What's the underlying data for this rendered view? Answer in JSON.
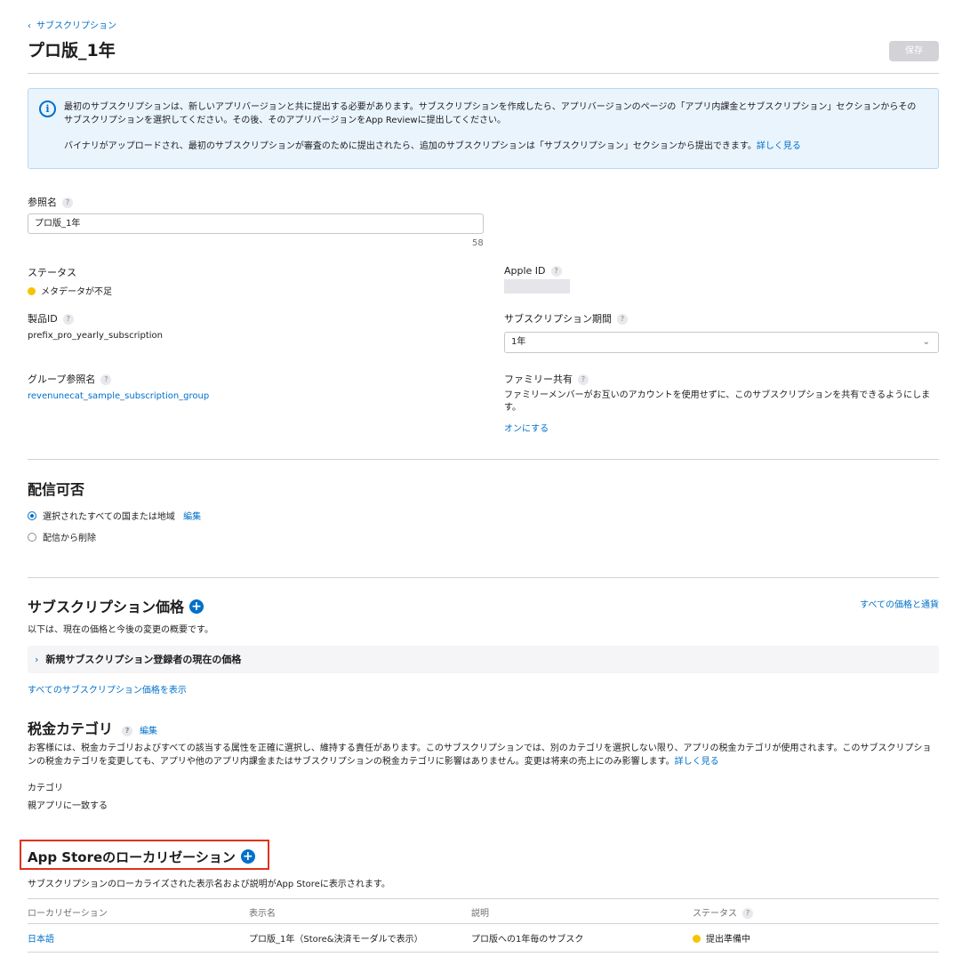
{
  "breadcrumb": {
    "label": "サブスクリプション"
  },
  "header": {
    "title": "プロ版_1年",
    "save_label": "保存"
  },
  "info": {
    "text1": "最初のサブスクリプションは、新しいアプリバージョンと共に提出する必要があります。サブスクリプションを作成したら、アプリバージョンのページの「アプリ内課金とサブスクリプション」セクションからそのサブスクリプションを選択してください。その後、そのアプリバージョンをApp Reviewに提出してください。",
    "text2": "バイナリがアップロードされ、最初のサブスクリプションが審査のために提出されたら、追加のサブスクリプションは「サブスクリプション」セクションから提出できます。",
    "link": "詳しく見る"
  },
  "reference_name": {
    "label": "参照名",
    "value": "プロ版_1年",
    "remaining": "58"
  },
  "status": {
    "label": "ステータス",
    "value": "メタデータが不足"
  },
  "apple_id": {
    "label": "Apple ID"
  },
  "product_id": {
    "label": "製品ID",
    "value": "prefix_pro_yearly_subscription"
  },
  "period": {
    "label": "サブスクリプション期間",
    "value": "1年"
  },
  "group": {
    "label": "グループ参照名",
    "value": "revenunecat_sample_subscription_group"
  },
  "family": {
    "label": "ファミリー共有",
    "desc": "ファミリーメンバーがお互いのアカウントを使用せずに、このサブスクリプションを共有できるようにします。",
    "link": "オンにする"
  },
  "availability": {
    "title": "配信可否",
    "option1": "選択されたすべての国または地域",
    "edit": "編集",
    "option2": "配信から削除"
  },
  "pricing": {
    "title": "サブスクリプション価格",
    "all_link": "すべての価格と通貨",
    "desc": "以下は、現在の価格と今後の変更の概要です。",
    "row": "新規サブスクリプション登録者の現在の価格",
    "show_all": "すべてのサブスクリプション価格を表示"
  },
  "tax": {
    "title": "税金カテゴリ",
    "edit": "編集",
    "desc": "お客様には、税金カテゴリおよびすべての該当する属性を正確に選択し、維持する責任があります。このサブスクリプションでは、別のカテゴリを選択しない限り、アプリの税金カテゴリが使用されます。このサブスクリプションの税金カテゴリを変更しても、アプリや他のアプリ内課金またはサブスクリプションの税金カテゴリに影響はありません。変更は将来の売上にのみ影響します。",
    "link": "詳しく見る",
    "category_label": "カテゴリ",
    "category_value": "親アプリに一致する"
  },
  "localization": {
    "title": "App Storeのローカリゼーション",
    "desc": "サブスクリプションのローカライズされた表示名および説明がApp Storeに表示されます。",
    "columns": [
      "ローカリゼーション",
      "表示名",
      "説明",
      "ステータス"
    ],
    "rows": [
      {
        "locale": "日本語",
        "display_name": "プロ版_1年（Store&決済モーダルで表示）",
        "description": "プロ版への1年毎のサブスク",
        "status": "提出準備中"
      }
    ]
  },
  "colors": {
    "accent": "#0070c9",
    "warning": "#f5c400",
    "highlight": "#e0321c",
    "info_bg": "#eaf4fd"
  }
}
